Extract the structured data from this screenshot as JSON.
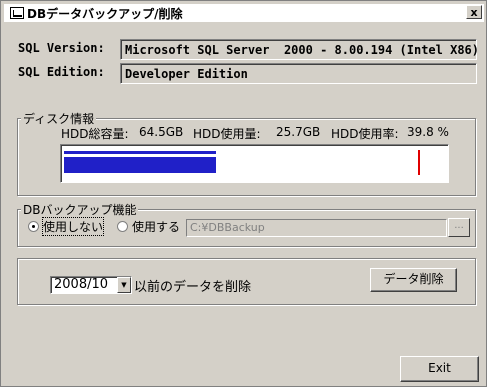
{
  "window": {
    "title": "DBデータバックアップ/削除",
    "close_label": "x"
  },
  "sql": {
    "version_label": "SQL Version:",
    "version_value": "Microsoft SQL Server  2000 - 8.00.194 (Intel X86)",
    "edition_label": "SQL Edition:",
    "edition_value": "Developer Edition"
  },
  "disk": {
    "group_label": "ディスク情報",
    "total_label": "HDD総容量:",
    "total_value": "64.5GB",
    "used_label": "HDD使用量:",
    "used_value": "25.7GB",
    "rate_label": "HDD使用率:",
    "rate_value": "39.8 %",
    "usage_fraction": 0.398,
    "marker_fraction": 0.93
  },
  "backup": {
    "group_label": "DBバックアップ機能",
    "option_off": "使用しない",
    "option_on": "使用する",
    "selected": "off",
    "path_value": "C:¥DBBackup",
    "browse_label": "..."
  },
  "delete": {
    "month_value": "2008/10",
    "suffix_label": "以前のデータを削除",
    "delete_button": "データ削除"
  },
  "footer": {
    "exit_button": "Exit"
  },
  "colors": {
    "progress_fill": "#2020c8",
    "progress_marker": "#e00000",
    "dialog_face": "#d4d0c8"
  }
}
